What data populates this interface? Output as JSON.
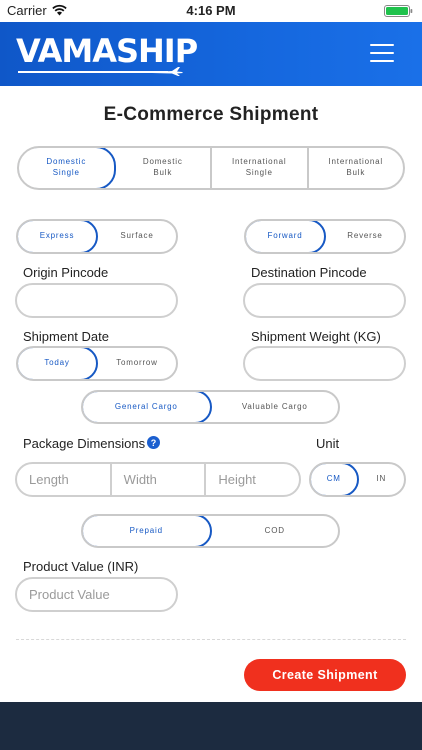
{
  "status_bar": {
    "carrier": "Carrier",
    "time": "4:16 PM"
  },
  "header": {
    "logo": "VAMASHIP"
  },
  "page_title": "E-Commerce Shipment",
  "shipment_type": {
    "options": [
      "Domestic Single",
      "Domestic Bulk",
      "International Single",
      "International Bulk"
    ],
    "selected": "Domestic Single"
  },
  "service_mode": {
    "options": [
      "Express",
      "Surface"
    ],
    "selected": "Express"
  },
  "direction": {
    "options": [
      "Forward",
      "Reverse"
    ],
    "selected": "Forward"
  },
  "labels": {
    "origin_pincode": "Origin Pincode",
    "destination_pincode": "Destination Pincode",
    "shipment_date": "Shipment Date",
    "shipment_weight": "Shipment Weight (KG)",
    "package_dimensions": "Package Dimensions",
    "unit": "Unit",
    "product_value": "Product Value (INR)"
  },
  "shipment_date": {
    "options": [
      "Today",
      "Tomorrow"
    ],
    "selected": "Today"
  },
  "cargo_type": {
    "options": [
      "General Cargo",
      "Valuable Cargo"
    ],
    "selected": "General Cargo"
  },
  "dimensions": {
    "length_placeholder": "Length",
    "width_placeholder": "Width",
    "height_placeholder": "Height"
  },
  "unit": {
    "options": [
      "CM",
      "IN"
    ],
    "selected": "CM"
  },
  "payment": {
    "options": [
      "Prepaid",
      "COD"
    ],
    "selected": "Prepaid"
  },
  "product_value": {
    "placeholder": "Product Value"
  },
  "create_button": "Create Shipment",
  "colors": {
    "brand_blue": "#1759c4",
    "header_blue": "#1567de",
    "cta_red": "#f0301e",
    "footer_navy": "#1c2b40"
  },
  "icons": {
    "wifi": "wifi-icon",
    "battery": "battery-icon",
    "menu": "hamburger-menu-icon",
    "help": "help-icon",
    "logo_mark": "airplane-icon"
  }
}
